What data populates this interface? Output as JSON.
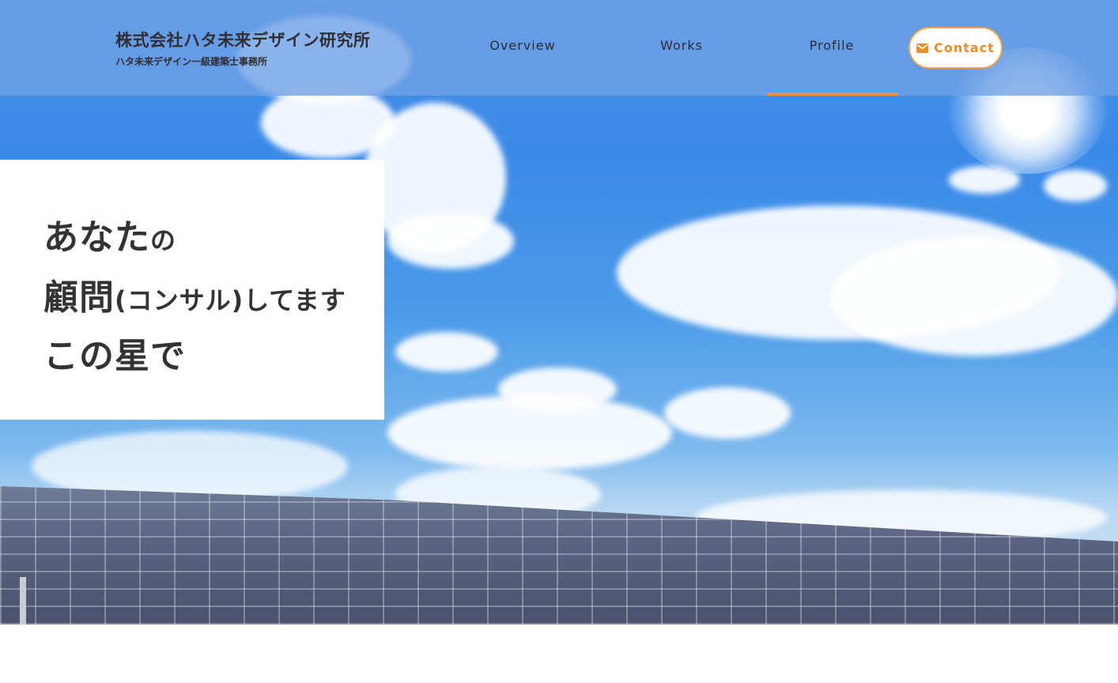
{
  "header": {
    "company_name": "株式会社ハタ未来デザイン研究所",
    "company_sub": "ハタ未来デザイン一級建築士事務所"
  },
  "nav": {
    "items": [
      {
        "label": "Overview"
      },
      {
        "label": "Works"
      },
      {
        "label": "Profile",
        "active": true
      }
    ],
    "contact_label": "Contact",
    "contact_icon": "mail-icon"
  },
  "hero": {
    "line1_big": "あなた",
    "line1_small": "の",
    "line2_big": "顧問",
    "line2_small": "(コンサル)してます",
    "line3_big": "この星で"
  },
  "colors": {
    "accent": "#e8963a",
    "header_bg": "#6ea0e6",
    "text_dark": "#333333"
  }
}
